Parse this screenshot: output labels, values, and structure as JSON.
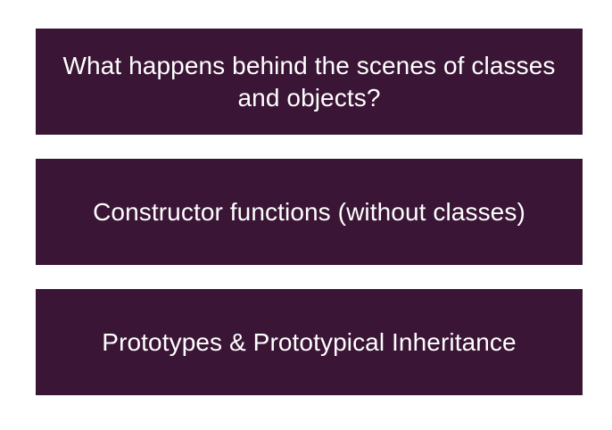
{
  "colors": {
    "box_background": "#3a1535",
    "text": "#ffffff",
    "page_background": "#ffffff"
  },
  "topics": [
    {
      "label": "What happens behind the scenes of classes and objects?"
    },
    {
      "label": "Constructor functions (without classes)"
    },
    {
      "label": "Prototypes & Prototypical Inheritance"
    }
  ]
}
